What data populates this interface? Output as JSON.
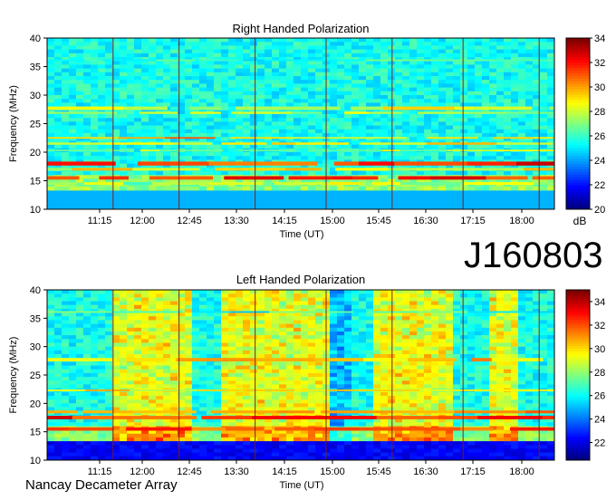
{
  "identifier": "J160803",
  "footer": "Nancay Decameter Array",
  "chart_data": [
    {
      "type": "heatmap",
      "title": "Right Handed Polarization",
      "xlabel": "Time (UT)",
      "ylabel": "Frequency (MHz)",
      "x_ticks": [
        "11:15",
        "12:00",
        "12:45",
        "13:30",
        "14:15",
        "15:00",
        "15:45",
        "16:30",
        "17:15",
        "18:00"
      ],
      "ylim": [
        10,
        40
      ],
      "y_ticks": [
        10,
        15,
        20,
        25,
        30,
        35,
        40
      ],
      "colorbar": {
        "label": "dB",
        "range": [
          20,
          34
        ],
        "ticks": [
          20,
          22,
          24,
          26,
          28,
          30,
          32,
          34
        ]
      },
      "emission_bands": [
        {
          "freq": 27.7,
          "level": 30,
          "width": 0.6
        },
        {
          "freq": 26.9,
          "level": 29,
          "width": 0.4
        },
        {
          "freq": 22.5,
          "level": 31,
          "width": 0.3
        },
        {
          "freq": 21.5,
          "level": 30,
          "width": 0.4
        },
        {
          "freq": 20.3,
          "level": 29,
          "width": 0.3
        },
        {
          "freq": 18.0,
          "level": 33,
          "width": 0.7
        },
        {
          "freq": 17.0,
          "level": 30,
          "width": 0.5
        },
        {
          "freq": 15.5,
          "level": 33,
          "width": 0.6
        },
        {
          "freq": 14.5,
          "level": 29,
          "width": 0.5
        },
        {
          "freq": 36.1,
          "level": 27,
          "width": 0.3
        }
      ]
    },
    {
      "type": "heatmap",
      "title": "Left Handed Polarization",
      "xlabel": "Time (UT)",
      "ylabel": "Frequency (MHz)",
      "x_ticks": [
        "11:15",
        "12:00",
        "12:45",
        "13:30",
        "14:15",
        "15:00",
        "15:45",
        "16:30",
        "17:15",
        "18:00"
      ],
      "ylim": [
        10,
        40
      ],
      "y_ticks": [
        10,
        15,
        20,
        25,
        30,
        35,
        40
      ],
      "colorbar": {
        "label": "",
        "range": [
          20.5,
          35
        ],
        "ticks": [
          22,
          24,
          26,
          28,
          30,
          32,
          34
        ]
      },
      "emission_bands": [
        {
          "freq": 27.7,
          "level": 32,
          "width": 0.6
        },
        {
          "freq": 22.3,
          "level": 31,
          "width": 0.3
        },
        {
          "freq": 18.5,
          "level": 33,
          "width": 0.5
        },
        {
          "freq": 17.5,
          "level": 34,
          "width": 0.6
        },
        {
          "freq": 15.5,
          "level": 33,
          "width": 0.6
        },
        {
          "freq": 36.1,
          "level": 28,
          "width": 0.3
        }
      ]
    }
  ]
}
